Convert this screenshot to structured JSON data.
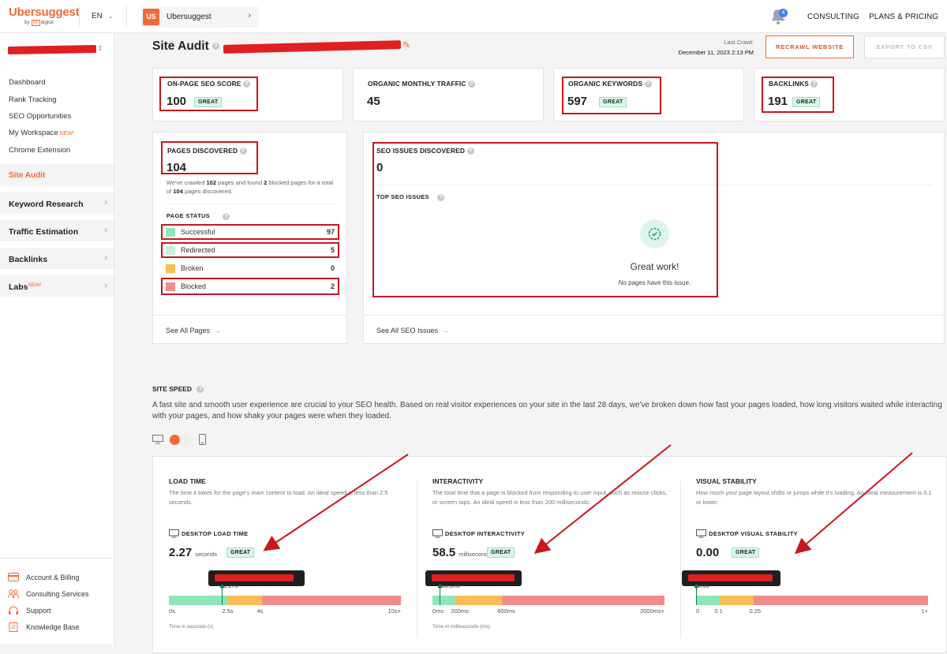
{
  "topbar": {
    "logo": "Ubersuggest",
    "logo_by": "by",
    "logo_np": "NP",
    "logo_digital": "digital",
    "language": "EN",
    "project_badge": "US",
    "project_name": "Ubersuggest",
    "notification_count": "4",
    "consulting": "CONSULTING",
    "plans_pricing": "PLANS & PRICING"
  },
  "sidebar": {
    "items": [
      "Dashboard",
      "Rank Tracking",
      "SEO Opportunities",
      "My Workspace",
      "Chrome Extension"
    ],
    "workspace_new": "NEW!",
    "active_item": "Site Audit",
    "sections": [
      "Keyword Research",
      "Traffic Estimation",
      "Backlinks",
      "Labs"
    ],
    "labs_new": "NEW!",
    "footer": [
      "Account & Billing",
      "Consulting Services",
      "Support",
      "Knowledge Base"
    ]
  },
  "header": {
    "title": "Site Audit",
    "last_crawl_label": "Last Crawl:",
    "last_crawl_date": "December 11, 2023 2:13 PM",
    "recrawl_button": "RECRAWL WEBSITE",
    "export_button": "EXPORT TO CSV"
  },
  "metrics": [
    {
      "label": "ON-PAGE SEO SCORE",
      "value": "100",
      "badge": "GREAT"
    },
    {
      "label": "ORGANIC MONTHLY TRAFFIC",
      "value": "45",
      "badge": ""
    },
    {
      "label": "ORGANIC KEYWORDS",
      "value": "597",
      "badge": "GREAT"
    },
    {
      "label": "BACKLINKS",
      "value": "191",
      "badge": "GREAT"
    }
  ],
  "pages": {
    "label": "PAGES DISCOVERED",
    "value": "104",
    "desc_1": "We've crawled",
    "crawled": "102",
    "desc_2": "pages and found",
    "blocked": "2",
    "desc_3": "blocked pages for a total of",
    "total": "104",
    "desc_4": "pages discovered.",
    "status_title": "PAGE STATUS",
    "statuses": [
      {
        "name": "Successful",
        "count": "97",
        "color": "#8ee6b8"
      },
      {
        "name": "Redirected",
        "count": "5",
        "color": "#c6efdd"
      },
      {
        "name": "Broken",
        "count": "0",
        "color": "#f7be55"
      },
      {
        "name": "Blocked",
        "count": "2",
        "color": "#f28b8b"
      }
    ],
    "see_all": "See All Pages"
  },
  "issues": {
    "label": "SEO ISSUES DISCOVERED",
    "value": "0",
    "top_title": "TOP SEO ISSUES",
    "great_work": "Great work!",
    "no_pages": "No pages have this issue.",
    "see_all": "See All SEO Issues"
  },
  "site_speed": {
    "title": "SITE SPEED",
    "description": "A fast site and smooth user experience are crucial to your SEO health. Based on real visitor experiences on your site in the last 28 days, we've broken down how fast your pages loaded, how long visitors waited while interacting with your pages, and how shaky your pages were when they loaded.",
    "columns": [
      {
        "title": "LOAD TIME",
        "desc": "The time it takes for the page's main content to load. An ideal speed is less than 2.5 seconds.",
        "metric_label": "DESKTOP LOAD TIME",
        "value": "2.27",
        "unit": "seconds",
        "badge": "GREAT",
        "marker_label": "2.27s",
        "marker_fraction": 0.227,
        "segments": [
          0.25,
          0.15,
          0.6
        ],
        "ticks": [
          "0s",
          "2.5s",
          "4s",
          "10s+"
        ],
        "axis_caption": "Time in seconds (s)"
      },
      {
        "title": "INTERACTIVITY",
        "desc": "The total time that a page is blocked from responding to user input, such as mouse clicks, or screen taps. An ideal speed is less than 200 milliseconds.",
        "metric_label": "DESKTOP INTERACTIVITY",
        "value": "58.5",
        "unit": "milliseconds",
        "badge": "GREAT",
        "marker_label": "58.5ms",
        "marker_fraction": 0.029,
        "segments": [
          0.1,
          0.2,
          0.7
        ],
        "ticks": [
          "0ms",
          "200ms",
          "600ms",
          "2000ms+"
        ],
        "axis_caption": "Time in milliseconds (ms)"
      },
      {
        "title": "VISUAL STABILITY",
        "desc": "How much your page layout shifts or jumps while it's loading. An ideal measurement is 0.1 or lower.",
        "metric_label": "DESKTOP VISUAL STABILITY",
        "value": "0.00",
        "unit": "",
        "badge": "GREAT",
        "marker_label": "0.00",
        "marker_fraction": 0.0,
        "segments": [
          0.1,
          0.15,
          0.75
        ],
        "ticks": [
          "0",
          "0.1",
          "0.25",
          "1+"
        ],
        "axis_caption": ""
      }
    ]
  },
  "colors": {
    "accent": "#f06b36",
    "green": "#8ee6b8",
    "yellow": "#f7be55",
    "red": "#f28b8b",
    "annotation": "#c8161d"
  }
}
